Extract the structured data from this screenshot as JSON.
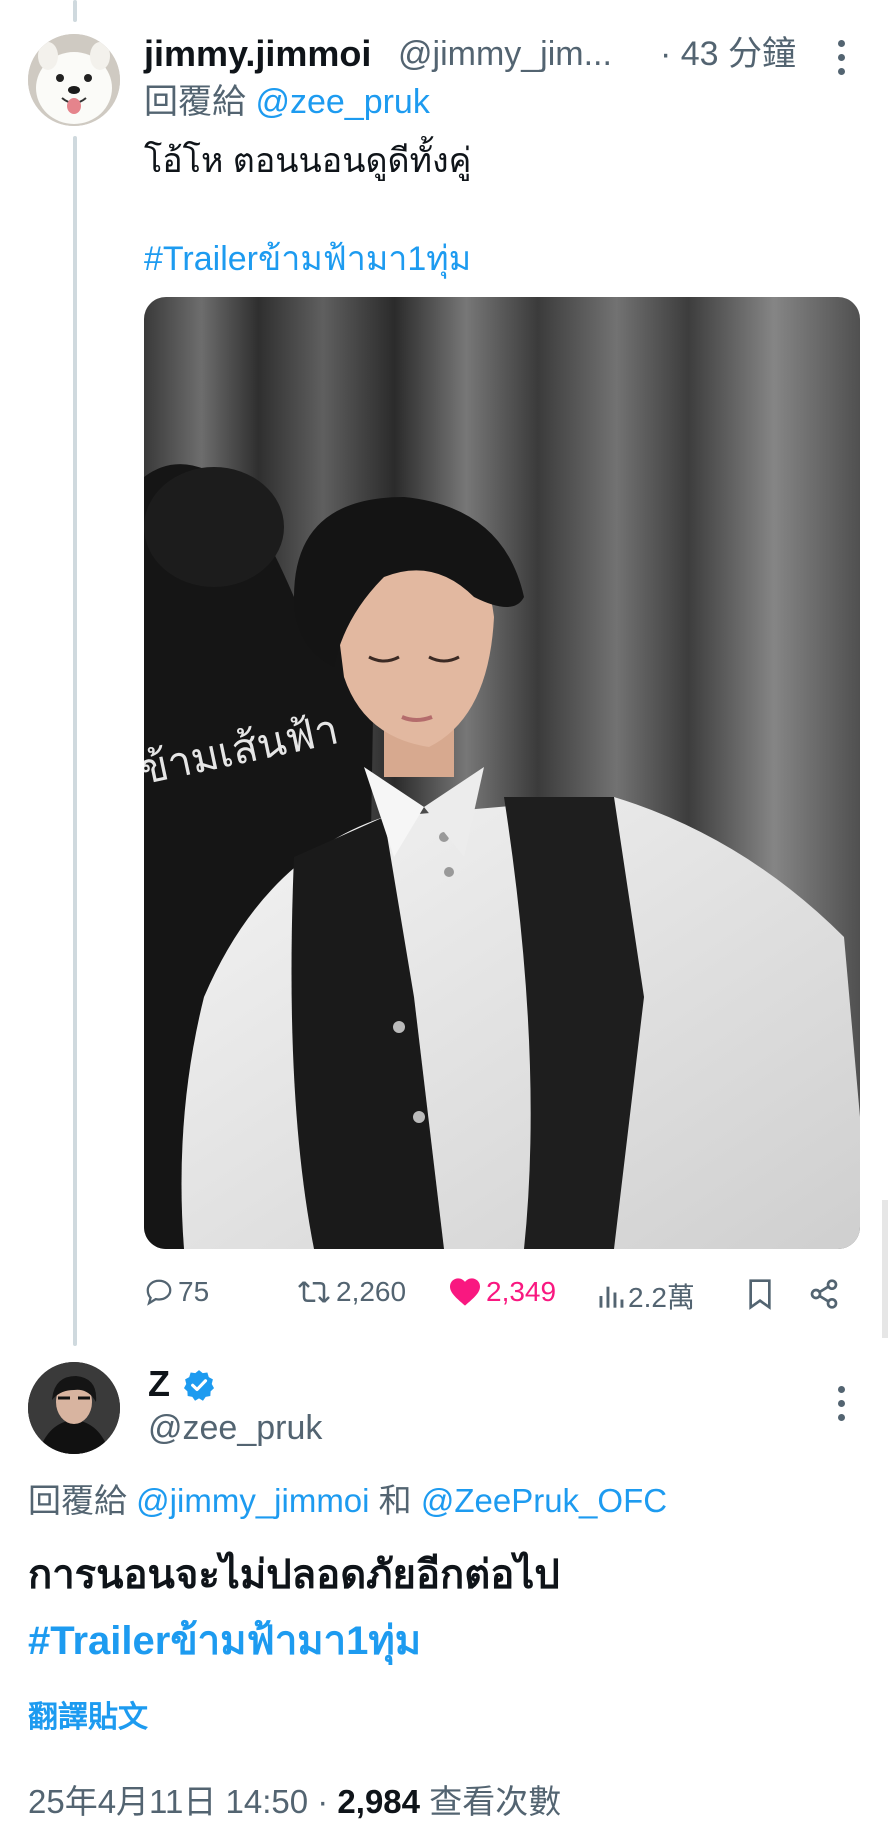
{
  "reply_tweet": {
    "display_name": "jimmy.jimmoi",
    "handle": "@jimmy_jim...",
    "time": "· 43 分鐘",
    "reply_prefix": "回覆給",
    "reply_to": "@zee_pruk",
    "text": "โอ้โห ตอนนอนดูดีทั้งคู่",
    "hashtag": "#Trailerข้ามฟ้ามา1ทุ่ม",
    "avatar_icon": "samoyed-dog-avatar",
    "photo_watermark": "ข้ามเส้นฟ้า",
    "actions": {
      "replies": "75",
      "reposts": "2,260",
      "likes": "2,349",
      "views": "2.2萬"
    }
  },
  "main_tweet": {
    "display_name": "Z",
    "verified": true,
    "handle": "@zee_pruk",
    "reply_prefix": "回覆給",
    "reply_to_1": "@jimmy_jimmoi",
    "reply_joiner": "和",
    "reply_to_2": "@ZeePruk_OFC",
    "text": "การนอนจะไม่ปลอดภัยอีกต่อไป",
    "hashtag": "#Trailerข้ามฟ้ามา1ทุ่ม",
    "translate": "翻譯貼文",
    "timestamp": "25年4月11日 14:50",
    "separator": "·",
    "view_count": "2,984",
    "view_label": "查看次數"
  },
  "colors": {
    "link": "#1d9bf0",
    "like": "#f91880",
    "muted": "#536471",
    "verified": "#1d9bf0"
  }
}
